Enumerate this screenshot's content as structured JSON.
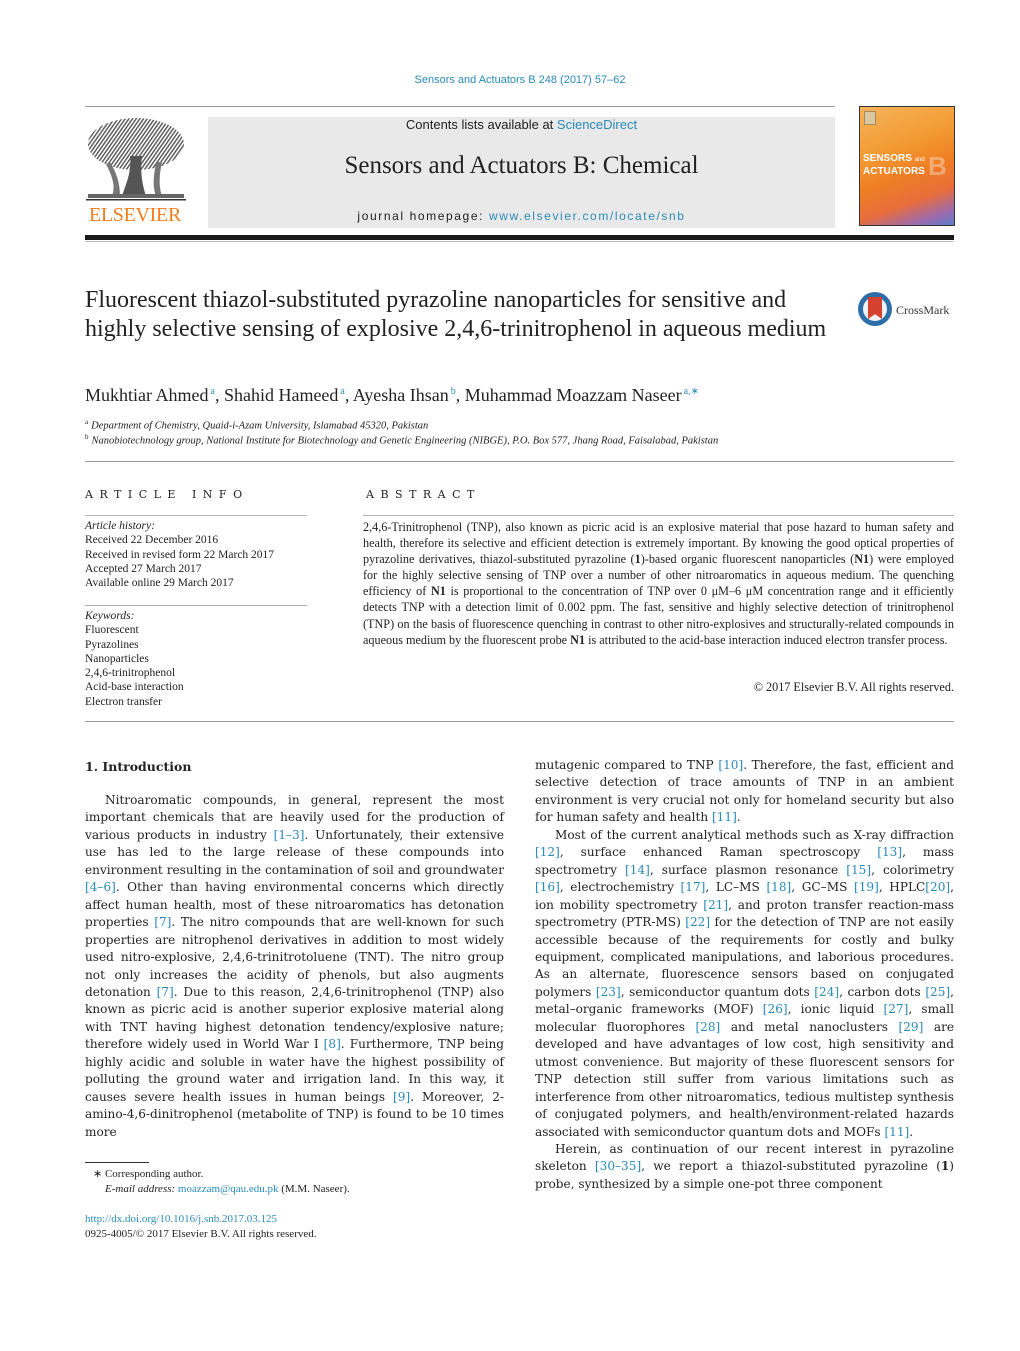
{
  "header": {
    "journal_reference": "Sensors and Actuators B 248 (2017) 57–62",
    "contents_prefix": "Contents lists available at ",
    "contents_link": "ScienceDirect",
    "journal_title": "Sensors and Actuators B: Chemical",
    "homepage_prefix": "journal homepage: ",
    "homepage_link": "www.elsevier.com/locate/snb",
    "publisher_wordmark": "ELSEVIER",
    "cover": {
      "title_line1": "SENSORS",
      "title_and": "and",
      "title_line2": "ACTUATORS",
      "letter": "B",
      "colors": {
        "orange": "#ef7f23",
        "purple": "#9b6ab0"
      }
    },
    "crossmark_label": "CrossMark",
    "link_color": "#2a8ab8",
    "elsevier_orange": "#f07e1c"
  },
  "article": {
    "title": "Fluorescent thiazol-substituted pyrazoline nanoparticles for sensitive and highly selective sensing of explosive 2,4,6-trinitrophenol in aqueous medium",
    "authors": [
      {
        "name": "Mukhtiar Ahmed",
        "affil": "a"
      },
      {
        "name": "Shahid Hameed",
        "affil": "a"
      },
      {
        "name": "Ayesha Ihsan",
        "affil": "b"
      },
      {
        "name": "Muhammad Moazzam Naseer",
        "affil": "a,∗"
      }
    ],
    "affiliations": [
      {
        "mark": "a",
        "text": "Department of Chemistry, Quaid-i-Azam University, Islamabad 45320, Pakistan"
      },
      {
        "mark": "b",
        "text": "Nanobiotechnology group, National Institute for Biotechnology and Genetic Engineering (NIBGE), P.O. Box 577, Jhang Road, Faisalabad, Pakistan"
      }
    ]
  },
  "article_info": {
    "heading": "ARTICLE INFO",
    "history_label": "Article history:",
    "history": [
      "Received 22 December 2016",
      "Received in revised form 22 March 2017",
      "Accepted 27 March 2017",
      "Available online 29 March 2017"
    ],
    "keywords_label": "Keywords:",
    "keywords": [
      "Fluorescent",
      "Pyrazolines",
      "Nanoparticles",
      "2,4,6-trinitrophenol",
      "Acid-base interaction",
      "Electron transfer"
    ]
  },
  "abstract": {
    "heading": "ABSTRACT",
    "segments": [
      {
        "t": "2,4,6-Trinitrophenol (TNP), also known as picric acid is an explosive material that pose hazard to human safety and health, therefore its selective and efficient detection is extremely important. By knowing the good optical properties of pyrazoline derivatives, thiazol-substituted pyrazoline ("
      },
      {
        "t": "1",
        "b": true
      },
      {
        "t": ")-based organic fluorescent nanoparticles ("
      },
      {
        "t": "N1",
        "b": true
      },
      {
        "t": ") were employed for the highly selective sensing of TNP over a number of other nitroaromatics in aqueous medium. The quenching efficiency of "
      },
      {
        "t": "N1",
        "b": true
      },
      {
        "t": " is proportional to the concentration of TNP over 0 μM–6 μM concentration range and it efficiently detects TNP with a detection limit of 0.002 ppm. The fast, sensitive and highly selective detection of trinitrophenol (TNP) on the basis of fluorescence quenching in contrast to other nitro-explosives and structurally-related compounds in aqueous medium by the fluorescent probe "
      },
      {
        "t": "N1",
        "b": true
      },
      {
        "t": " is attributed to the acid-base interaction induced electron transfer process."
      }
    ],
    "copyright": "© 2017 Elsevier B.V. All rights reserved."
  },
  "introduction": {
    "heading": "1.  Introduction",
    "paragraphs": [
      {
        "column": "left",
        "indent": true,
        "segments": [
          {
            "t": "Nitroaromatic compounds, in general, represent the most important chemicals that are heavily used for the production of various products in industry "
          },
          {
            "t": "[1–3]",
            "c": true
          },
          {
            "t": ". Unfortunately, their extensive use has led to the large release of these compounds into environment resulting in the contamination of soil and groundwater "
          },
          {
            "t": "[4–6]",
            "c": true
          },
          {
            "t": ". Other than having environmental concerns which directly affect human health, most of these nitroaromatics has detonation properties "
          },
          {
            "t": "[7]",
            "c": true
          },
          {
            "t": ". The nitro compounds that are well-known for such properties are nitrophenol derivatives in addition to most widely used nitro-explosive, 2,4,6-trinitrotoluene (TNT). The nitro group not only increases the acidity of phenols, but also augments detonation "
          },
          {
            "t": "[7]",
            "c": true
          },
          {
            "t": ". Due to this reason, 2,4,6-trinitrophenol (TNP) also known as picric acid is another superior explosive material along with TNT having highest detonation tendency/explosive nature; therefore widely used in World War I "
          },
          {
            "t": "[8]",
            "c": true
          },
          {
            "t": ". Furthermore, TNP being highly acidic and soluble in water have the highest possibility of polluting the ground water and irrigation land. In this way, it causes severe health issues in human beings "
          },
          {
            "t": "[9]",
            "c": true
          },
          {
            "t": ". Moreover, 2-amino-4,6-dinitrophenol (metabolite of TNP) is found to be 10 times more"
          }
        ]
      },
      {
        "column": "right",
        "indent": false,
        "segments": [
          {
            "t": "mutagenic compared to TNP "
          },
          {
            "t": "[10]",
            "c": true
          },
          {
            "t": ". Therefore, the fast, efficient and selective detection of trace amounts of TNP in an ambient environment is very crucial not only for homeland security but also for human safety and health "
          },
          {
            "t": "[11]",
            "c": true
          },
          {
            "t": "."
          }
        ]
      },
      {
        "column": "right",
        "indent": true,
        "segments": [
          {
            "t": "Most of the current analytical methods such as X-ray diffraction "
          },
          {
            "t": "[12]",
            "c": true
          },
          {
            "t": ", surface enhanced Raman spectroscopy "
          },
          {
            "t": "[13]",
            "c": true
          },
          {
            "t": ", mass spectrometry "
          },
          {
            "t": "[14]",
            "c": true
          },
          {
            "t": ", surface plasmon resonance "
          },
          {
            "t": "[15]",
            "c": true
          },
          {
            "t": ", colorimetry "
          },
          {
            "t": "[16]",
            "c": true
          },
          {
            "t": ", electrochemistry "
          },
          {
            "t": "[17]",
            "c": true
          },
          {
            "t": ", LC–MS "
          },
          {
            "t": "[18]",
            "c": true
          },
          {
            "t": ", GC–MS "
          },
          {
            "t": "[19]",
            "c": true
          },
          {
            "t": ", HPLC"
          },
          {
            "t": "[20]",
            "c": true
          },
          {
            "t": ", ion mobility spectrometry "
          },
          {
            "t": "[21]",
            "c": true
          },
          {
            "t": ", and proton transfer reaction-mass spectrometry (PTR-MS) "
          },
          {
            "t": "[22]",
            "c": true
          },
          {
            "t": " for the detection of TNP are not easily accessible because of the requirements for costly and bulky equipment, complicated manipulations, and laborious procedures. As an alternate, fluorescence sensors based on conjugated polymers "
          },
          {
            "t": "[23]",
            "c": true
          },
          {
            "t": ", semiconductor quantum dots "
          },
          {
            "t": "[24]",
            "c": true
          },
          {
            "t": ", carbon dots "
          },
          {
            "t": "[25]",
            "c": true
          },
          {
            "t": ", metal–organic frameworks (MOF) "
          },
          {
            "t": "[26]",
            "c": true
          },
          {
            "t": ", ionic liquid "
          },
          {
            "t": "[27]",
            "c": true
          },
          {
            "t": ", small molecular fluorophores "
          },
          {
            "t": "[28]",
            "c": true
          },
          {
            "t": " and metal nanoclusters "
          },
          {
            "t": "[29]",
            "c": true
          },
          {
            "t": " are developed and have advantages of low cost, high sensitivity and utmost convenience. But majority of these fluorescent sensors for TNP detection still suffer from various limitations such as interference from other nitroaromatics, tedious multistep synthesis of conjugated polymers, and health/environment-related hazards associated with semiconductor quantum dots and MOFs "
          },
          {
            "t": "[11]",
            "c": true
          },
          {
            "t": "."
          }
        ]
      },
      {
        "column": "right",
        "indent": true,
        "segments": [
          {
            "t": "Herein, as continuation of our recent interest in pyrazoline skeleton "
          },
          {
            "t": "[30–35]",
            "c": true
          },
          {
            "t": ", we report a thiazol-substituted pyrazoline ("
          },
          {
            "t": "1",
            "b": true
          },
          {
            "t": ") probe, synthesized by a simple one-pot three component"
          }
        ]
      }
    ]
  },
  "footnotes": {
    "corresponding_mark": "∗",
    "corresponding_label": "Corresponding author.",
    "email_label": "E-mail address:",
    "email": "moazzam@qau.edu.pk",
    "email_suffix": "(M.M. Naseer).",
    "doi": "http://dx.doi.org/10.1016/j.snb.2017.03.125",
    "issn_copyright": "0925-4005/© 2017 Elsevier B.V. All rights reserved."
  }
}
